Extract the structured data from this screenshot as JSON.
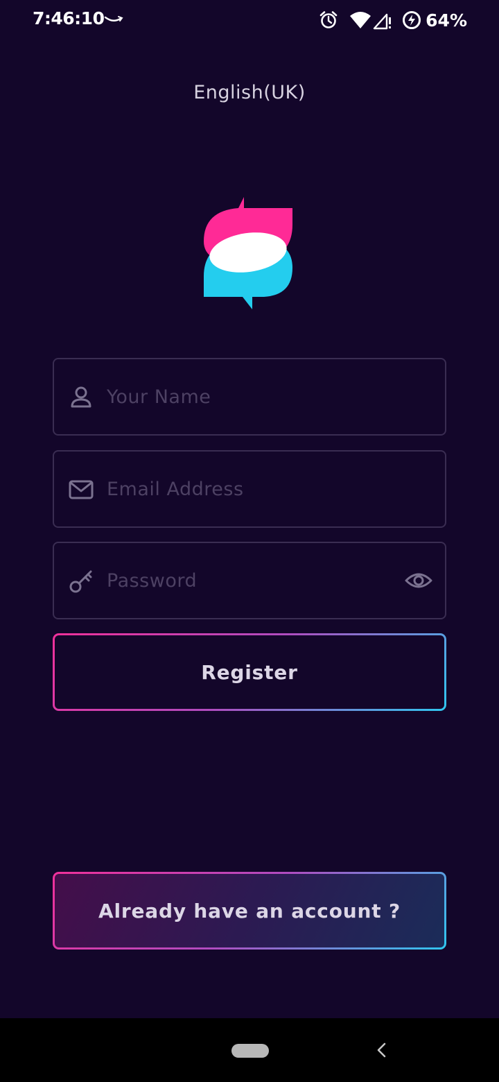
{
  "status_bar": {
    "time": "7:46:10",
    "battery": "64%"
  },
  "language": "English(UK)",
  "form": {
    "name_placeholder": "Your Name",
    "email_placeholder": "Email Address",
    "password_placeholder": "Password",
    "register_label": "Register"
  },
  "login_label": "Already have an account ?",
  "icons": [
    "amazon-smile-icon",
    "alarm-icon",
    "wifi-icon",
    "signal-icon",
    "battery-saver-icon",
    "user-icon",
    "mail-icon",
    "key-icon",
    "eye-icon",
    "home-pill-icon",
    "back-chevron-icon"
  ],
  "colors": {
    "background": "#13062a",
    "accent_pink": "#f0309a",
    "accent_cyan": "#2fc7f0",
    "field_border": "#3a2d52",
    "placeholder": "#4d4163"
  }
}
